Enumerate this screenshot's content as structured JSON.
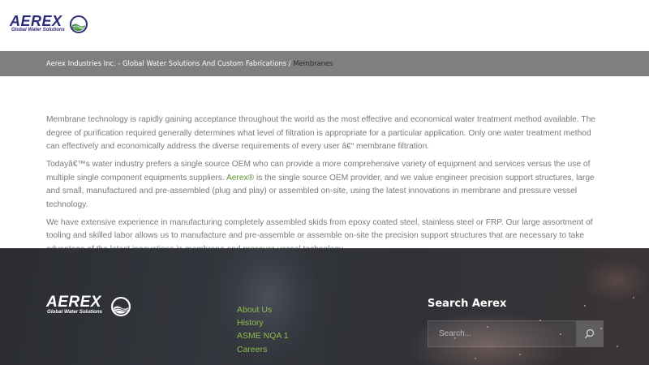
{
  "header": {
    "logo": {
      "wordmark": "AEREX",
      "tagline": "Global Water Solutions"
    }
  },
  "breadcrumb": {
    "home": "Aerex Industries Inc. - Global Water Solutions And Custom Fabrications",
    "separator": "/",
    "current": "Membranes"
  },
  "content": {
    "p1": "Membrane technology is rapidly gaining acceptance throughout the world as the most effective and economical water treatment method available. The degree of purification required generally determines what level of filtration is appropriate for a particular application. Only one water treatment method can effectively and economically address the diverse requirements of every user â€“ membrane filtration.",
    "p2_before": "Todayâ€™s water industry prefers a single source OEM who can provide a more comprehensive variety of equipment and services versus the use of multiple single component equipments suppliers. ",
    "p2_link": "Aerex®",
    "p2_after": " is the single source OEM provider, and we value engineer precision support structures, large and small, manufactured and pre-assembled (plug and play) or assembled on-site, using the latest innovations in membrane and pressure vessel technology.",
    "p3": "We have extensive experience in manufacturing completely assembled skids from epoxy coated steel, stainless steel or FRP. Our large assortment of tooling and skilled labor allows us to manufacture and pre-assemble or assemble on-site the precision support structures that are necessary to take advantage of the latest innovations in membrane and pressure vessel technology."
  },
  "footer": {
    "logo": {
      "wordmark": "AEREX",
      "tagline": "Global Water Solutions"
    },
    "links": [
      {
        "label": "About Us"
      },
      {
        "label": "History"
      },
      {
        "label": "ASME NQA 1"
      },
      {
        "label": "Careers"
      }
    ],
    "search": {
      "title": "Search Aerex",
      "placeholder": "Search...",
      "button_icon": "search-icon"
    }
  },
  "colors": {
    "brand_navy": "#2e2a7a",
    "brand_green": "#3f8f3a",
    "link_green": "#5e8f2e",
    "footer_link_green": "#8bbf4a",
    "breadcrumb_bg": "#7f7f7f"
  }
}
